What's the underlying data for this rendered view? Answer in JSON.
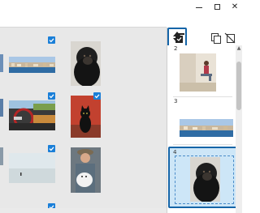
{
  "window": {
    "controls": [
      "minimize-icon",
      "maximize-icon",
      "close-icon"
    ]
  },
  "side_toolbar": {
    "icons": [
      "select-pages-icon",
      "reorder-icon",
      "duplicate-icon",
      "delete-icon"
    ],
    "active": "reorder-icon"
  },
  "side_pages": [
    {
      "number": "2",
      "image": "person-sitting-photo"
    },
    {
      "number": "3",
      "image": "coastal-city-photo"
    },
    {
      "number": "4",
      "image": "gorilla-photo",
      "selected": true
    }
  ],
  "grid": {
    "thumbnails": [
      {
        "image": "coastal-city-photo",
        "checked": true
      },
      {
        "image": "gorilla-photo",
        "checked": false
      },
      {
        "image": "car-interior-photo",
        "checked": true
      },
      {
        "image": "black-cat-photo",
        "checked": true
      },
      {
        "image": "beach-photo",
        "checked": true
      },
      {
        "image": "man-with-dog-photo",
        "checked": false
      }
    ]
  },
  "colors": {
    "accent": "#1565a8",
    "check": "#1a7fd8",
    "selection_fill": "#cde6f7",
    "grid_background": "#e8e8e8"
  }
}
